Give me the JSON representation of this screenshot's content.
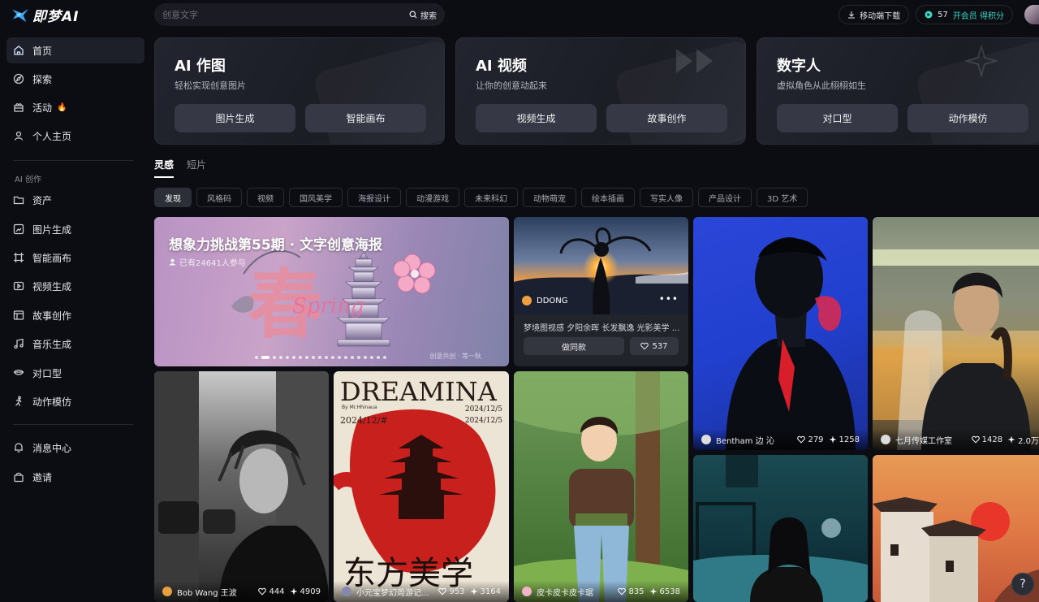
{
  "brand": {
    "name": "即梦AI"
  },
  "sidebar": {
    "items": [
      {
        "label": "首页",
        "icon": "home-icon"
      },
      {
        "label": "探索",
        "icon": "compass-icon"
      },
      {
        "label": "活动",
        "icon": "gift-icon",
        "badge": "🔥"
      },
      {
        "label": "个人主页",
        "icon": "user-icon"
      }
    ],
    "section_label": "AI 创作",
    "create_items": [
      {
        "label": "资产",
        "icon": "folder-icon"
      },
      {
        "label": "图片生成",
        "icon": "image-gen-icon"
      },
      {
        "label": "智能画布",
        "icon": "canvas-icon"
      },
      {
        "label": "视频生成",
        "icon": "video-gen-icon"
      },
      {
        "label": "故事创作",
        "icon": "story-icon"
      },
      {
        "label": "音乐生成",
        "icon": "music-icon"
      },
      {
        "label": "对口型",
        "icon": "lip-sync-icon"
      },
      {
        "label": "动作模仿",
        "icon": "motion-icon"
      }
    ],
    "bottom_items": [
      {
        "label": "消息中心",
        "icon": "bell-icon"
      },
      {
        "label": "邀请",
        "icon": "invite-icon"
      }
    ]
  },
  "search": {
    "placeholder": "创意文字",
    "button": "搜索"
  },
  "topbar": {
    "download": "移动端下载",
    "credits": "57",
    "vip": "开会员 得积分"
  },
  "features": [
    {
      "title": "AI 作图",
      "subtitle": "轻松实现创意图片",
      "buttons": [
        "图片生成",
        "智能画布"
      ]
    },
    {
      "title": "AI 视频",
      "subtitle": "让你的创意动起来",
      "buttons": [
        "视频生成",
        "故事创作"
      ]
    },
    {
      "title": "数字人",
      "subtitle": "虚拟角色从此栩栩如生",
      "buttons": [
        "对口型",
        "动作模仿"
      ]
    }
  ],
  "tabs": [
    "灵感",
    "短片"
  ],
  "chips": [
    "发现",
    "风格码",
    "视频",
    "国风美学",
    "海报设计",
    "动漫游戏",
    "未来科幻",
    "动物萌宠",
    "绘本插画",
    "写实人像",
    "产品设计",
    "3D 艺术"
  ],
  "banner": {
    "title": "想象力挑战第55期 · 文字创意海报",
    "participants": "已有24641人参与",
    "caption": "创意共创 · 等一秋",
    "art_text": "春",
    "art_text2": "Spring"
  },
  "ddong": {
    "author": "DDONG",
    "desc": "梦境图视感 夕阳余晖 长发飘逸 光影美学 ...",
    "same_label": "做同款",
    "likes": "537",
    "more": "•••"
  },
  "feed": [
    {
      "author": "Bentham 边 沁",
      "likes": "279",
      "uses": "1258"
    },
    {
      "author": "七月传媒工作室",
      "likes": "1428",
      "uses": "2.0万"
    },
    {
      "author": "Bob Wang 王波",
      "likes": "444",
      "uses": "4909"
    },
    {
      "author": "小元宝梦幻周游记...",
      "likes": "953",
      "uses": "3164"
    },
    {
      "author": "皮卡皮卡皮卡琚",
      "likes": "835",
      "uses": "6538"
    }
  ],
  "poster": {
    "big": "DREAMINA",
    "date1": "2024/12/5",
    "date2": "2024/12/5",
    "small": "2024/12/#",
    "bottom": "东方美学",
    "by": "By Mr.Hhinaua"
  },
  "help": "?"
}
